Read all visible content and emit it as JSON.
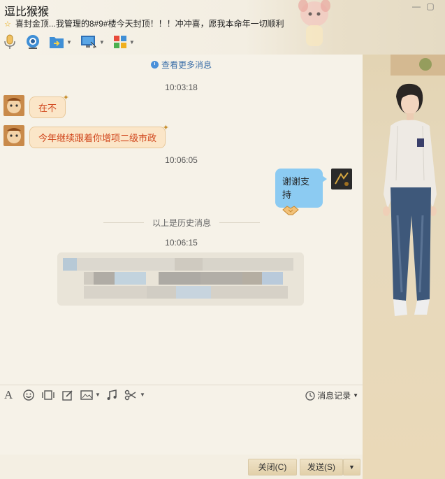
{
  "window": {
    "title": "逗比猴猴",
    "controls": [
      "minimize-icon",
      "maximize-icon"
    ],
    "signature": "喜封金顶...我管理的8#9#楼今天封顶！！！冲冲喜，愿我本命年一切顺利"
  },
  "toolbar": {
    "items": [
      "voice-icon",
      "video-icon",
      "file-transfer-icon",
      "remote-desktop-icon",
      "apps-icon"
    ]
  },
  "chat": {
    "more_link": "查看更多消息",
    "messages": [
      {
        "time": "10:03:18",
        "side": "left",
        "text": "在不"
      },
      {
        "time": "",
        "side": "left",
        "text": "今年继续跟着你增项二级市政"
      },
      {
        "time": "10:06:05",
        "side": "right",
        "text": "谢谢支持",
        "emoji": "handshake-icon"
      }
    ],
    "history_separator": "以上是历史消息",
    "latest_time": "10:06:15"
  },
  "input_toolbar": {
    "items": [
      "font-icon",
      "emoji-icon",
      "screen-shake-icon",
      "draw-icon",
      "image-icon",
      "music-icon",
      "scissors-icon"
    ],
    "history_label": "消息记录"
  },
  "footer": {
    "close_label": "关闭(C)",
    "send_label": "发送(S)"
  },
  "colors": {
    "accent_blue": "#3a6ea8",
    "bubble_left": "#fbe6c8",
    "bubble_left_text": "#d0451b",
    "bubble_right": "#8ccbf2"
  }
}
